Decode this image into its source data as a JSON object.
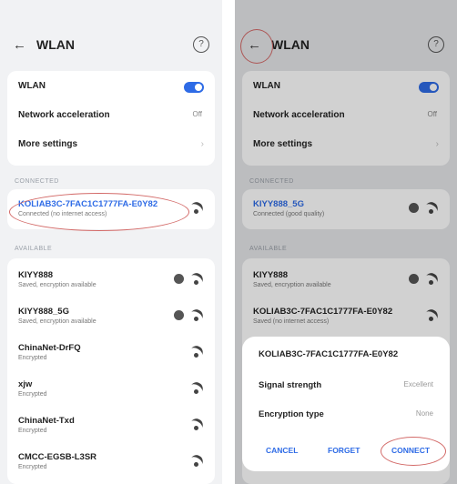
{
  "left": {
    "status_left": "",
    "status_right": "",
    "title": "WLAN",
    "settings": [
      {
        "label": "WLAN"
      },
      {
        "label": "Network acceleration",
        "value": "Off"
      },
      {
        "label": "More settings"
      }
    ],
    "connected_header": "CONNECTED",
    "connected": {
      "name": "KOLIAB3C-7FAC1C1777FA-E0Y82",
      "status": "Connected (no internet access)"
    },
    "available_header": "AVAILABLE",
    "available": [
      {
        "name": "KIYY888",
        "status": "Saved, encryption available"
      },
      {
        "name": "KIYY888_5G",
        "status": "Saved, encryption available"
      },
      {
        "name": "ChinaNet-DrFQ",
        "status": "Encrypted"
      },
      {
        "name": "xjw",
        "status": "Encrypted"
      },
      {
        "name": "ChinaNet-Txd",
        "status": "Encrypted"
      },
      {
        "name": "CMCC-EGSB-L3SR",
        "status": "Encrypted"
      }
    ]
  },
  "right": {
    "title": "WLAN",
    "settings": [
      {
        "label": "WLAN"
      },
      {
        "label": "Network acceleration",
        "value": "Off"
      },
      {
        "label": "More settings"
      }
    ],
    "connected_header": "CONNECTED",
    "connected": {
      "name": "KIYY888_5G",
      "status": "Connected (good quality)"
    },
    "available_header": "AVAILABLE",
    "available": [
      {
        "name": "KIYY888",
        "status": "Saved, encryption available"
      },
      {
        "name": "KOLIAB3C-7FAC1C1777FA-E0Y82",
        "status": "Saved (no internet access)"
      }
    ],
    "dialog": {
      "title": "KOLIAB3C-7FAC1C1777FA-E0Y82",
      "signal_label": "Signal strength",
      "signal_value": "Excellent",
      "encryption_label": "Encryption type",
      "encryption_value": "None",
      "cancel": "CANCEL",
      "forget": "FORGET",
      "connect": "CONNECT"
    }
  },
  "colors": {
    "accent": "#2e6be6",
    "highlight_oval": "#d36a68"
  }
}
